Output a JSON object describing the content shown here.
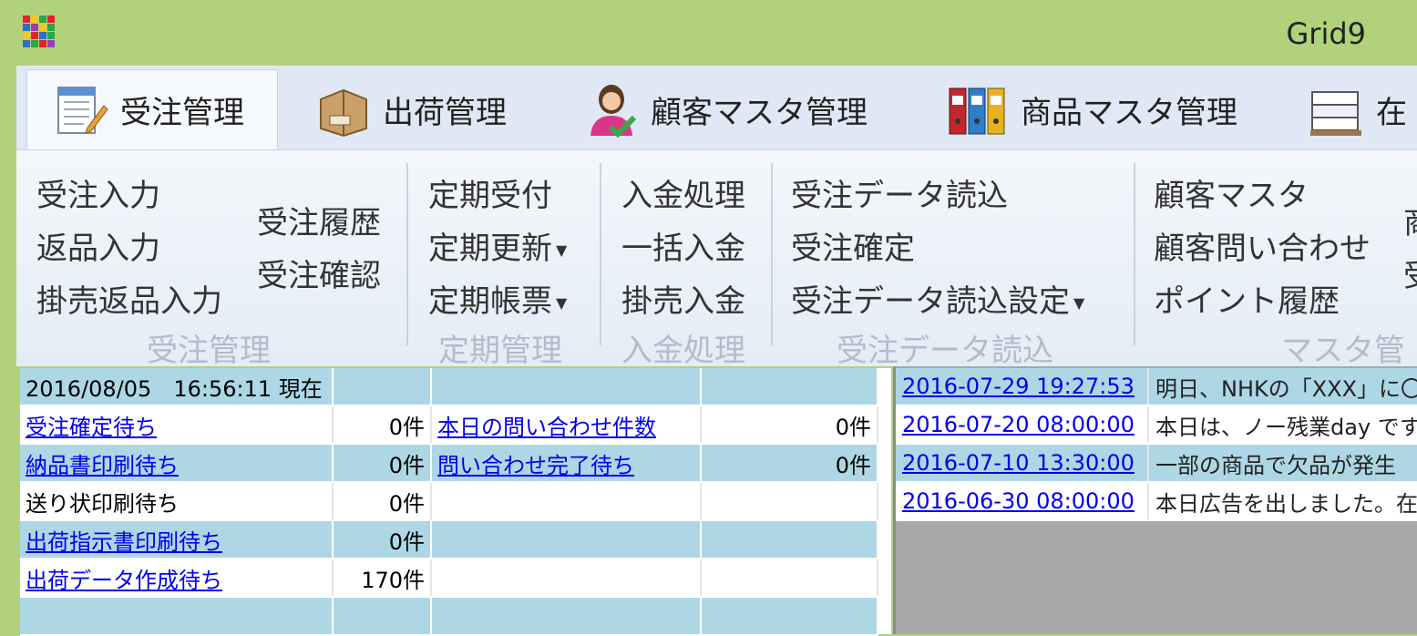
{
  "window": {
    "title": "Grid9"
  },
  "tabs": [
    {
      "label": "受注管理",
      "icon": "order-form-icon"
    },
    {
      "label": "出荷管理",
      "icon": "shipping-box-icon"
    },
    {
      "label": "顧客マスタ管理",
      "icon": "customer-icon"
    },
    {
      "label": "商品マスタ管理",
      "icon": "binders-icon"
    },
    {
      "label": "在",
      "icon": "inventory-boxes-icon"
    }
  ],
  "ribbon": {
    "order": {
      "group_label": "受注管理",
      "entry": "受注入力",
      "returns": "返品入力",
      "credit_returns": "掛売返品入力",
      "history": "受注履歴",
      "confirm": "受注確認"
    },
    "regular": {
      "group_label": "定期管理",
      "accept": "定期受付",
      "update": "定期更新",
      "forms": "定期帳票"
    },
    "payment": {
      "group_label": "入金処理",
      "process": "入金処理",
      "bulk": "一括入金",
      "credit": "掛売入金"
    },
    "import": {
      "group_label": "受注データ読込",
      "read": "受注データ読込",
      "finalize": "受注確定",
      "settings": "受注データ読込設定"
    },
    "master": {
      "group_label": "マスタ管",
      "customer": "顧客マスタ",
      "inquiry": "顧客問い合わせ",
      "points": "ポイント履歴",
      "extra1": "商",
      "extra2": "受"
    }
  },
  "status": {
    "timestamp": "2016/08/05　16:56:11 現在",
    "rows": [
      {
        "label": "受注確定待ち",
        "count": "0件",
        "link": true,
        "label2": "本日の問い合わせ件数",
        "count2": "0件"
      },
      {
        "label": "納品書印刷待ち",
        "count": "0件",
        "link": true,
        "label2": "問い合わせ完了待ち",
        "count2": "0件"
      },
      {
        "label": "送り状印刷待ち",
        "count": "0件",
        "link": false,
        "label2": "",
        "count2": ""
      },
      {
        "label": "出荷指示書印刷待ち",
        "count": "0件",
        "link": true,
        "label2": "",
        "count2": ""
      },
      {
        "label": "出荷データ作成待ち",
        "count": "170件",
        "link": true,
        "label2": "",
        "count2": ""
      }
    ]
  },
  "news": [
    {
      "date": "2016-07-29 19:27:53",
      "text": "明日、NHKの「XXX」に〇〇"
    },
    {
      "date": "2016-07-20 08:00:00",
      "text": "本日は、ノー残業day です"
    },
    {
      "date": "2016-07-10 13:30:00",
      "text": "一部の商品で欠品が発生"
    },
    {
      "date": "2016-06-30 08:00:00",
      "text": "本日広告を出しました。在"
    }
  ],
  "colors": {
    "titlebar": "#b1d27a",
    "row_blue": "#aed7e5",
    "link": "#0000ee"
  }
}
